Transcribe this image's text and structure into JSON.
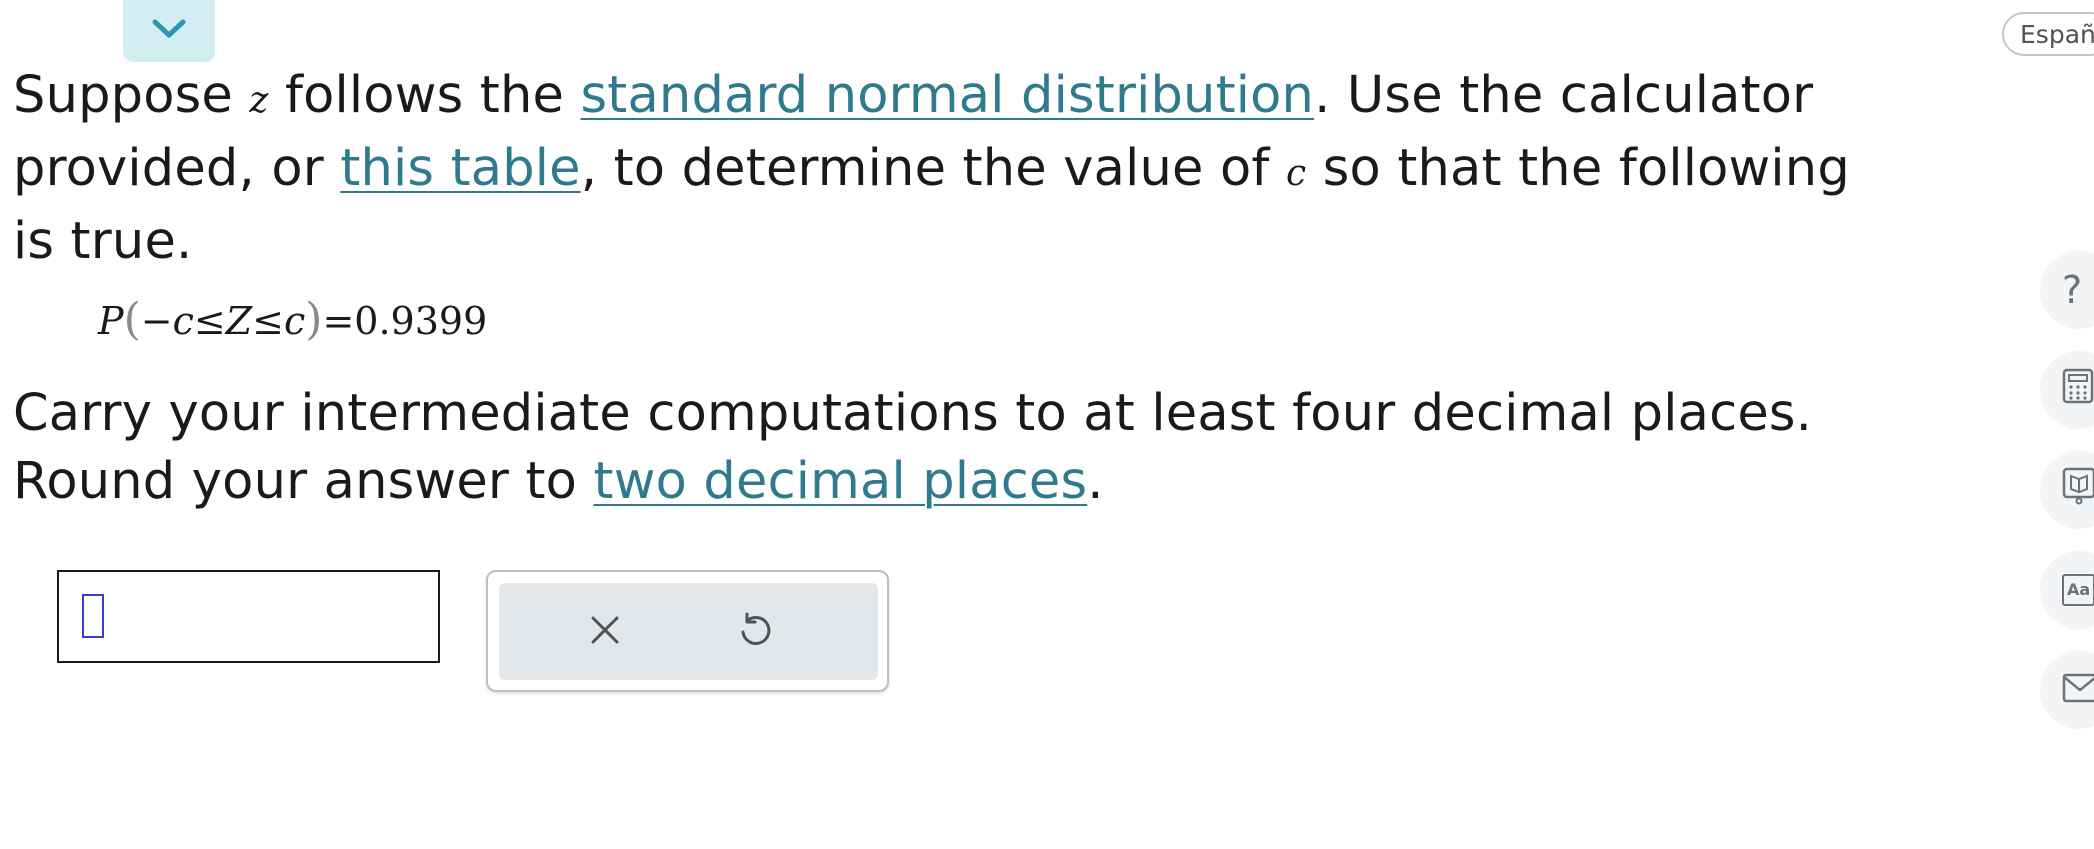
{
  "header": {
    "collapse_icon": "chevron-down-icon",
    "language_button": "Españ"
  },
  "question": {
    "line1_part1": "Suppose ",
    "var_z": "z",
    "line1_part2": " follows the ",
    "link_distribution": "standard normal distribution",
    "line1_part3": ". Use the calculator",
    "line2_part1": "provided, or ",
    "link_table": "this table",
    "line2_part2": ", to determine the value of ",
    "var_c": "c",
    "line2_part3": " so that the following",
    "line3": "is true."
  },
  "equation": {
    "p": "P",
    "open_paren": "(",
    "neg_c": "−c",
    "le1": "≤",
    "Z": "Z",
    "le2": "≤",
    "c": "c",
    "close_paren": ")",
    "equals": "=",
    "value": "0.9399"
  },
  "instructions": {
    "line1": "Carry your intermediate computations to at least four decimal places.",
    "line2_part1": "Round your answer to ",
    "link_decimal": "two decimal places",
    "line2_part2": "."
  },
  "answer": {
    "value": ""
  },
  "actions": {
    "clear_icon": "close-icon",
    "undo_icon": "undo-icon"
  },
  "side_tools": {
    "help_label": "?",
    "help_icon": "help-icon",
    "calculator_icon": "calculator-icon",
    "ebook_icon": "book-icon",
    "glossary_label": "Aa",
    "glossary_icon": "glossary-icon",
    "message_icon": "mail-icon"
  },
  "colors": {
    "link": "#2f7a8c",
    "tab_bg": "#d3eef3",
    "cursor": "#3b3bd1",
    "panel_bg": "#e3e7e9"
  }
}
